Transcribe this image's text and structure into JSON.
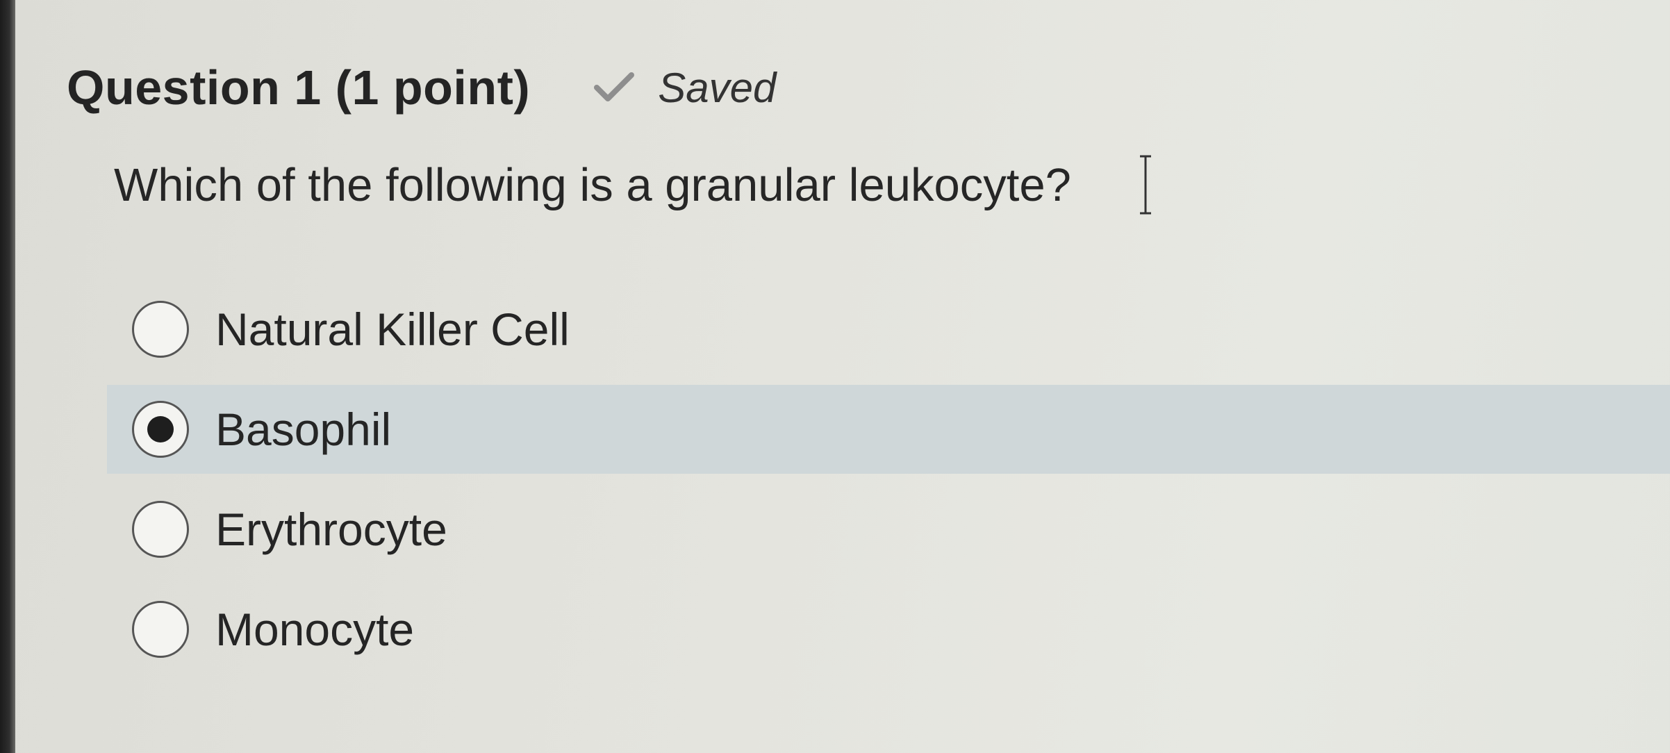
{
  "question": {
    "title": "Question 1 (1 point)",
    "status": "Saved",
    "status_icon": "check-icon",
    "text": "Which of the following is a granular leukocyte?"
  },
  "options": [
    {
      "label": "Natural Killer Cell",
      "selected": false
    },
    {
      "label": "Basophil",
      "selected": true
    },
    {
      "label": "Erythrocyte",
      "selected": false
    },
    {
      "label": "Monocyte",
      "selected": false
    }
  ],
  "colors": {
    "selected_row_background": "#cfd7d9",
    "page_background": "#e4e5df",
    "text": "#242424"
  }
}
